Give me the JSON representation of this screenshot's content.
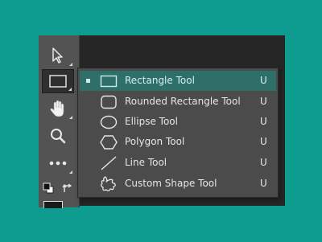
{
  "toolbar": {
    "tools": [
      {
        "name": "move-tool",
        "icon": "arrow-cursor-icon"
      },
      {
        "name": "rectangle-tool",
        "icon": "rectangle-icon",
        "active": true
      },
      {
        "name": "hand-tool",
        "icon": "hand-icon"
      },
      {
        "name": "zoom-tool",
        "icon": "magnifier-icon"
      },
      {
        "name": "edit-toolbar",
        "icon": "ellipsis-icon"
      },
      {
        "name": "default-colors",
        "icon": "default-colors-icon"
      },
      {
        "name": "swap-colors",
        "icon": "swap-colors-icon"
      }
    ]
  },
  "flyout": {
    "items": [
      {
        "label": "Rectangle Tool",
        "shortcut": "U",
        "icon": "rectangle-icon",
        "selected": true
      },
      {
        "label": "Rounded Rectangle Tool",
        "shortcut": "U",
        "icon": "rounded-rectangle-icon"
      },
      {
        "label": "Ellipse Tool",
        "shortcut": "U",
        "icon": "ellipse-icon"
      },
      {
        "label": "Polygon Tool",
        "shortcut": "U",
        "icon": "polygon-icon"
      },
      {
        "label": "Line Tool",
        "shortcut": "U",
        "icon": "line-icon"
      },
      {
        "label": "Custom Shape Tool",
        "shortcut": "U",
        "icon": "custom-shape-icon"
      }
    ]
  },
  "colors": {
    "background": "#0f9c90",
    "panel": "#535353",
    "flyout": "#4b4b4b",
    "selection": "#2f6f6a",
    "text": "#e6e6e6"
  }
}
